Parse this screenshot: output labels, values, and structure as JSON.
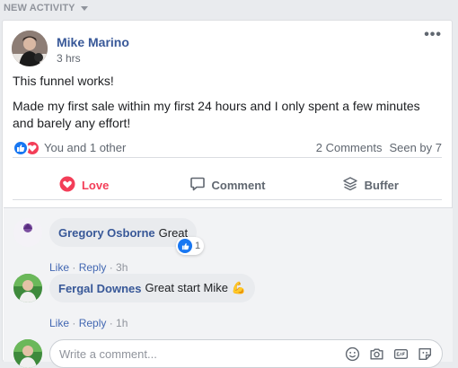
{
  "section": {
    "title": "NEW ACTIVITY"
  },
  "post": {
    "author": "Mike Marino",
    "time": "3 hrs",
    "paragraphs": [
      "This funnel works!",
      "Made my first sale within my first 24 hours and I only spent a few minutes and barely any effort!"
    ],
    "reactors": "You and 1 other",
    "comments_count": "2 Comments",
    "seen_by": "Seen by 7"
  },
  "actions": {
    "love": "Love",
    "comment": "Comment",
    "buffer": "Buffer"
  },
  "comments": [
    {
      "name": "Gregory Osborne",
      "text": "Great",
      "like": "Like",
      "reply": "Reply",
      "time": "3h",
      "reaction_count": "1",
      "avatar_text": "Gregory Osborne"
    },
    {
      "name": "Fergal Downes",
      "text": "Great start Mike 💪",
      "like": "Like",
      "reply": "Reply",
      "time": "1h"
    }
  ],
  "composer": {
    "placeholder": "Write a comment..."
  },
  "icons": [
    "caret-down-icon",
    "more-icon",
    "like-reaction-icon",
    "love-reaction-icon",
    "heart-icon",
    "comment-icon",
    "buffer-icon",
    "emoji-icon",
    "camera-icon",
    "gif-icon",
    "sticker-icon"
  ],
  "colors": {
    "link": "#385898",
    "love": "#f33e58",
    "like": "#1877f2"
  }
}
